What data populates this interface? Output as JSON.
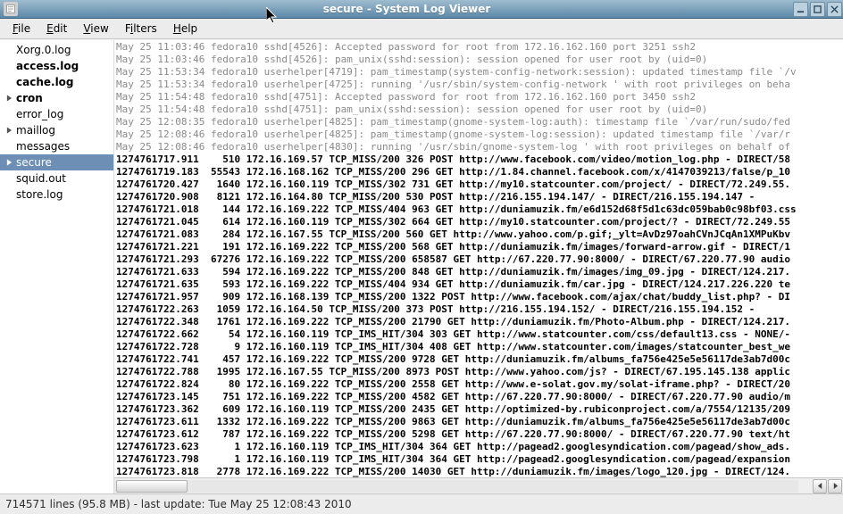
{
  "window": {
    "title": "secure - System Log Viewer"
  },
  "menus": {
    "file": "File",
    "edit": "Edit",
    "view": "View",
    "filters": "Filters",
    "help": "Help"
  },
  "sidebar": {
    "items": [
      {
        "label": "Xorg.0.log",
        "tw": false,
        "bold": false,
        "sel": false
      },
      {
        "label": "access.log",
        "tw": false,
        "bold": true,
        "sel": false
      },
      {
        "label": "cache.log",
        "tw": false,
        "bold": true,
        "sel": false
      },
      {
        "label": "cron",
        "tw": true,
        "bold": true,
        "sel": false
      },
      {
        "label": "error_log",
        "tw": false,
        "bold": false,
        "sel": false
      },
      {
        "label": "maillog",
        "tw": true,
        "bold": false,
        "sel": false
      },
      {
        "label": "messages",
        "tw": false,
        "bold": false,
        "sel": false
      },
      {
        "label": "secure",
        "tw": true,
        "bold": false,
        "sel": true
      },
      {
        "label": "squid.out",
        "tw": false,
        "bold": false,
        "sel": false
      },
      {
        "label": "store.log",
        "tw": false,
        "bold": false,
        "sel": false
      }
    ]
  },
  "log": {
    "lines": [
      {
        "dim": true,
        "bold": false,
        "text": "May 25 11:03:46 fedora10 sshd[4526]: Accepted password for root from 172.16.162.160 port 3251 ssh2"
      },
      {
        "dim": true,
        "bold": false,
        "text": "May 25 11:03:46 fedora10 sshd[4526]: pam_unix(sshd:session): session opened for user root by (uid=0)"
      },
      {
        "dim": true,
        "bold": false,
        "text": "May 25 11:53:34 fedora10 userhelper[4719]: pam_timestamp(system-config-network:session): updated timestamp file `/v"
      },
      {
        "dim": true,
        "bold": false,
        "text": "May 25 11:53:34 fedora10 userhelper[4725]: running '/usr/sbin/system-config-network ' with root privileges on beha"
      },
      {
        "dim": true,
        "bold": false,
        "text": "May 25 11:54:48 fedora10 sshd[4751]: Accepted password for root from 172.16.162.160 port 3450 ssh2"
      },
      {
        "dim": true,
        "bold": false,
        "text": "May 25 11:54:48 fedora10 sshd[4751]: pam_unix(sshd:session): session opened for user root by (uid=0)"
      },
      {
        "dim": true,
        "bold": false,
        "text": "May 25 12:08:35 fedora10 userhelper[4825]: pam_timestamp(gnome-system-log:auth): timestamp file `/var/run/sudo/fed"
      },
      {
        "dim": true,
        "bold": false,
        "text": "May 25 12:08:46 fedora10 userhelper[4825]: pam_timestamp(gnome-system-log:session): updated timestamp file `/var/r"
      },
      {
        "dim": true,
        "bold": false,
        "text": "May 25 12:08:46 fedora10 userhelper[4830]: running '/usr/sbin/gnome-system-log ' with root privileges on behalf of"
      },
      {
        "dim": false,
        "bold": true,
        "text": "1274761717.911    510 172.16.169.57 TCP_MISS/200 326 POST http://www.facebook.com/video/motion_log.php - DIRECT/58"
      },
      {
        "dim": false,
        "bold": true,
        "text": "1274761719.183  55543 172.16.168.162 TCP_MISS/200 296 GET http://1.84.channel.facebook.com/x/4147039213/false/p_10"
      },
      {
        "dim": false,
        "bold": true,
        "text": "1274761720.427   1640 172.16.160.119 TCP_MISS/302 731 GET http://my10.statcounter.com/project/ - DIRECT/72.249.55."
      },
      {
        "dim": false,
        "bold": true,
        "text": "1274761720.908   8121 172.16.164.80 TCP_MISS/200 530 POST http://216.155.194.147/ - DIRECT/216.155.194.147 -"
      },
      {
        "dim": false,
        "bold": true,
        "text": "1274761721.018    144 172.16.169.222 TCP_MISS/404 963 GET http://duniamuzik.fm/e6d152d68f5d1c63dc059bab0c98bf03.css"
      },
      {
        "dim": false,
        "bold": true,
        "text": "1274761721.045    614 172.16.160.119 TCP_MISS/302 664 GET http://my10.statcounter.com/project/? - DIRECT/72.249.55"
      },
      {
        "dim": false,
        "bold": true,
        "text": "1274761721.083    284 172.16.167.55 TCP_MISS/200 560 GET http://www.yahoo.com/p.gif;_ylt=AvDz97oahCVnJCqAn1XMPuKbv"
      },
      {
        "dim": false,
        "bold": true,
        "text": "1274761721.221    191 172.16.169.222 TCP_MISS/200 568 GET http://duniamuzik.fm/images/forward-arrow.gif - DIRECT/1"
      },
      {
        "dim": false,
        "bold": true,
        "text": "1274761721.293  67276 172.16.169.222 TCP_MISS/200 658587 GET http://67.220.77.90:8000/ - DIRECT/67.220.77.90 audio"
      },
      {
        "dim": false,
        "bold": true,
        "text": "1274761721.633    594 172.16.169.222 TCP_MISS/200 848 GET http://duniamuzik.fm/images/img_09.jpg - DIRECT/124.217."
      },
      {
        "dim": false,
        "bold": true,
        "text": "1274761721.635    593 172.16.169.222 TCP_MISS/404 934 GET http://duniamuzik.fm/car.jpg - DIRECT/124.217.226.220 te"
      },
      {
        "dim": false,
        "bold": true,
        "text": "1274761721.957    909 172.16.168.139 TCP_MISS/200 1322 POST http://www.facebook.com/ajax/chat/buddy_list.php? - DI"
      },
      {
        "dim": false,
        "bold": true,
        "text": "1274761722.263   1059 172.16.164.50 TCP_MISS/200 373 POST http://216.155.194.152/ - DIRECT/216.155.194.152 -"
      },
      {
        "dim": false,
        "bold": true,
        "text": "1274761722.348   1761 172.16.169.222 TCP_MISS/200 21790 GET http://duniamuzik.fm/Photo-Album.php - DIRECT/124.217."
      },
      {
        "dim": false,
        "bold": true,
        "text": "1274761722.662     54 172.16.160.119 TCP_IMS_HIT/304 303 GET http://www.statcounter.com/css/default13.css - NONE/-"
      },
      {
        "dim": false,
        "bold": true,
        "text": "1274761722.728      9 172.16.160.119 TCP_IMS_HIT/304 408 GET http://www.statcounter.com/images/statcounter_best_we"
      },
      {
        "dim": false,
        "bold": true,
        "text": "1274761722.741    457 172.16.169.222 TCP_MISS/200 9728 GET http://duniamuzik.fm/albums_fa756e425e5e56117de3ab7d00c"
      },
      {
        "dim": false,
        "bold": true,
        "text": "1274761722.788   1995 172.16.167.55 TCP_MISS/200 8973 POST http://www.yahoo.com/js? - DIRECT/67.195.145.138 applic"
      },
      {
        "dim": false,
        "bold": true,
        "text": "1274761722.824     80 172.16.169.222 TCP_MISS/200 2558 GET http://www.e-solat.gov.my/solat-iframe.php? - DIRECT/20"
      },
      {
        "dim": false,
        "bold": true,
        "text": "1274761723.145    751 172.16.169.222 TCP_MISS/200 4582 GET http://67.220.77.90:8000/ - DIRECT/67.220.77.90 audio/m"
      },
      {
        "dim": false,
        "bold": true,
        "text": "1274761723.362    609 172.16.160.119 TCP_MISS/200 2435 GET http://optimized-by.rubiconproject.com/a/7554/12135/209"
      },
      {
        "dim": false,
        "bold": true,
        "text": "1274761723.611   1332 172.16.169.222 TCP_MISS/200 9863 GET http://duniamuzik.fm/albums_fa756e425e5e56117de3ab7d00c"
      },
      {
        "dim": false,
        "bold": true,
        "text": "1274761723.612    787 172.16.169.222 TCP_MISS/200 5298 GET http://67.220.77.90:8000/ - DIRECT/67.220.77.90 text/ht"
      },
      {
        "dim": false,
        "bold": true,
        "text": "1274761723.623      1 172.16.160.119 TCP_IMS_HIT/304 364 GET http://pagead2.googlesyndication.com/pagead/show_ads."
      },
      {
        "dim": false,
        "bold": true,
        "text": "1274761723.798      1 172.16.160.119 TCP_IMS_HIT/304 364 GET http://pagead2.googlesyndication.com/pagead/expansion"
      },
      {
        "dim": false,
        "bold": true,
        "text": "1274761723.818   2778 172.16.169.222 TCP_MISS/200 14030 GET http://duniamuzik.fm/images/logo_120.jpg - DIRECT/124."
      }
    ]
  },
  "status": {
    "text": "714571 lines (95.8 MB) - last update: Tue May 25 12:08:43 2010"
  }
}
